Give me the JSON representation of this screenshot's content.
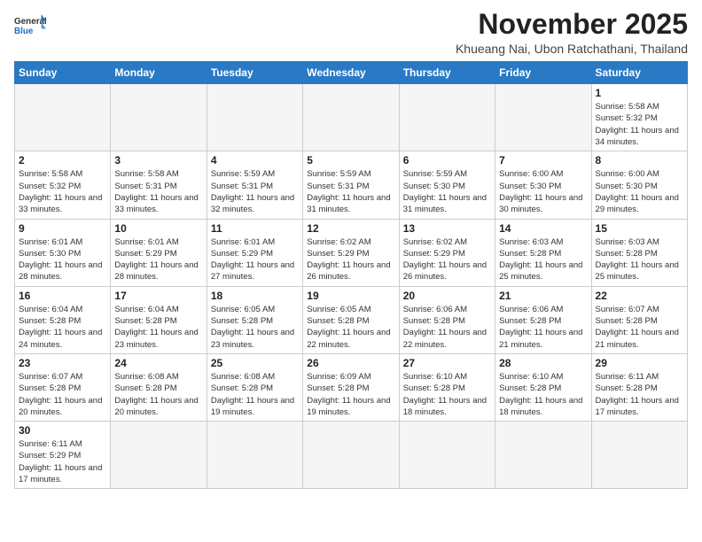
{
  "header": {
    "logo_general": "General",
    "logo_blue": "Blue",
    "month_title": "November 2025",
    "subtitle": "Khueang Nai, Ubon Ratchathani, Thailand"
  },
  "weekdays": [
    "Sunday",
    "Monday",
    "Tuesday",
    "Wednesday",
    "Thursday",
    "Friday",
    "Saturday"
  ],
  "weeks": [
    [
      {
        "day": "",
        "info": ""
      },
      {
        "day": "",
        "info": ""
      },
      {
        "day": "",
        "info": ""
      },
      {
        "day": "",
        "info": ""
      },
      {
        "day": "",
        "info": ""
      },
      {
        "day": "",
        "info": ""
      },
      {
        "day": "1",
        "info": "Sunrise: 5:58 AM\nSunset: 5:32 PM\nDaylight: 11 hours\nand 34 minutes."
      }
    ],
    [
      {
        "day": "2",
        "info": "Sunrise: 5:58 AM\nSunset: 5:32 PM\nDaylight: 11 hours\nand 33 minutes."
      },
      {
        "day": "3",
        "info": "Sunrise: 5:58 AM\nSunset: 5:31 PM\nDaylight: 11 hours\nand 33 minutes."
      },
      {
        "day": "4",
        "info": "Sunrise: 5:59 AM\nSunset: 5:31 PM\nDaylight: 11 hours\nand 32 minutes."
      },
      {
        "day": "5",
        "info": "Sunrise: 5:59 AM\nSunset: 5:31 PM\nDaylight: 11 hours\nand 31 minutes."
      },
      {
        "day": "6",
        "info": "Sunrise: 5:59 AM\nSunset: 5:30 PM\nDaylight: 11 hours\nand 31 minutes."
      },
      {
        "day": "7",
        "info": "Sunrise: 6:00 AM\nSunset: 5:30 PM\nDaylight: 11 hours\nand 30 minutes."
      },
      {
        "day": "8",
        "info": "Sunrise: 6:00 AM\nSunset: 5:30 PM\nDaylight: 11 hours\nand 29 minutes."
      }
    ],
    [
      {
        "day": "9",
        "info": "Sunrise: 6:01 AM\nSunset: 5:30 PM\nDaylight: 11 hours\nand 28 minutes."
      },
      {
        "day": "10",
        "info": "Sunrise: 6:01 AM\nSunset: 5:29 PM\nDaylight: 11 hours\nand 28 minutes."
      },
      {
        "day": "11",
        "info": "Sunrise: 6:01 AM\nSunset: 5:29 PM\nDaylight: 11 hours\nand 27 minutes."
      },
      {
        "day": "12",
        "info": "Sunrise: 6:02 AM\nSunset: 5:29 PM\nDaylight: 11 hours\nand 26 minutes."
      },
      {
        "day": "13",
        "info": "Sunrise: 6:02 AM\nSunset: 5:29 PM\nDaylight: 11 hours\nand 26 minutes."
      },
      {
        "day": "14",
        "info": "Sunrise: 6:03 AM\nSunset: 5:28 PM\nDaylight: 11 hours\nand 25 minutes."
      },
      {
        "day": "15",
        "info": "Sunrise: 6:03 AM\nSunset: 5:28 PM\nDaylight: 11 hours\nand 25 minutes."
      }
    ],
    [
      {
        "day": "16",
        "info": "Sunrise: 6:04 AM\nSunset: 5:28 PM\nDaylight: 11 hours\nand 24 minutes."
      },
      {
        "day": "17",
        "info": "Sunrise: 6:04 AM\nSunset: 5:28 PM\nDaylight: 11 hours\nand 23 minutes."
      },
      {
        "day": "18",
        "info": "Sunrise: 6:05 AM\nSunset: 5:28 PM\nDaylight: 11 hours\nand 23 minutes."
      },
      {
        "day": "19",
        "info": "Sunrise: 6:05 AM\nSunset: 5:28 PM\nDaylight: 11 hours\nand 22 minutes."
      },
      {
        "day": "20",
        "info": "Sunrise: 6:06 AM\nSunset: 5:28 PM\nDaylight: 11 hours\nand 22 minutes."
      },
      {
        "day": "21",
        "info": "Sunrise: 6:06 AM\nSunset: 5:28 PM\nDaylight: 11 hours\nand 21 minutes."
      },
      {
        "day": "22",
        "info": "Sunrise: 6:07 AM\nSunset: 5:28 PM\nDaylight: 11 hours\nand 21 minutes."
      }
    ],
    [
      {
        "day": "23",
        "info": "Sunrise: 6:07 AM\nSunset: 5:28 PM\nDaylight: 11 hours\nand 20 minutes."
      },
      {
        "day": "24",
        "info": "Sunrise: 6:08 AM\nSunset: 5:28 PM\nDaylight: 11 hours\nand 20 minutes."
      },
      {
        "day": "25",
        "info": "Sunrise: 6:08 AM\nSunset: 5:28 PM\nDaylight: 11 hours\nand 19 minutes."
      },
      {
        "day": "26",
        "info": "Sunrise: 6:09 AM\nSunset: 5:28 PM\nDaylight: 11 hours\nand 19 minutes."
      },
      {
        "day": "27",
        "info": "Sunrise: 6:10 AM\nSunset: 5:28 PM\nDaylight: 11 hours\nand 18 minutes."
      },
      {
        "day": "28",
        "info": "Sunrise: 6:10 AM\nSunset: 5:28 PM\nDaylight: 11 hours\nand 18 minutes."
      },
      {
        "day": "29",
        "info": "Sunrise: 6:11 AM\nSunset: 5:28 PM\nDaylight: 11 hours\nand 17 minutes."
      }
    ],
    [
      {
        "day": "30",
        "info": "Sunrise: 6:11 AM\nSunset: 5:29 PM\nDaylight: 11 hours\nand 17 minutes."
      },
      {
        "day": "",
        "info": ""
      },
      {
        "day": "",
        "info": ""
      },
      {
        "day": "",
        "info": ""
      },
      {
        "day": "",
        "info": ""
      },
      {
        "day": "",
        "info": ""
      },
      {
        "day": "",
        "info": ""
      }
    ]
  ]
}
